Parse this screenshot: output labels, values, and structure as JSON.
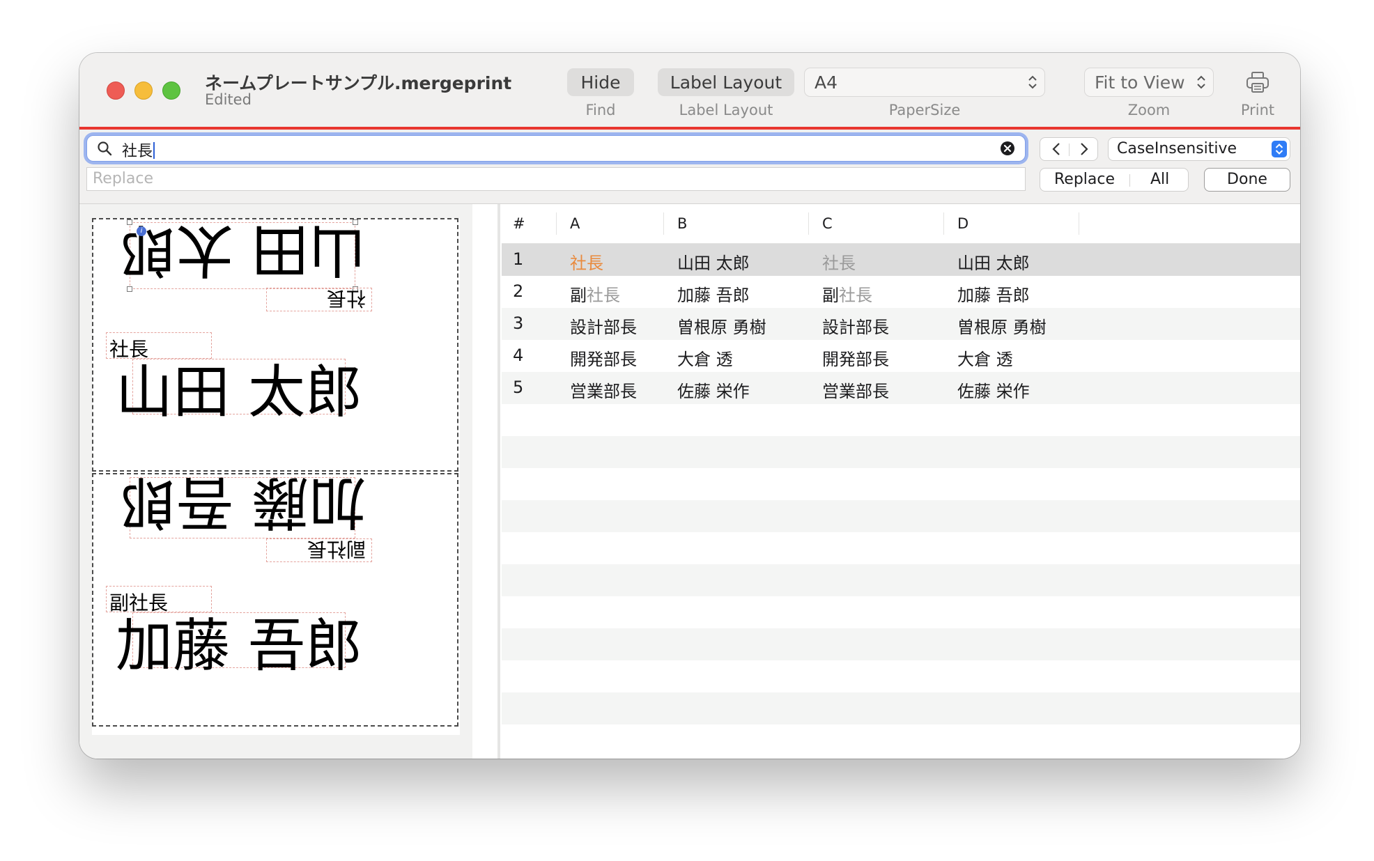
{
  "window": {
    "title": "ネームプレートサンプル.mergeprint",
    "subtitle": "Edited"
  },
  "toolbar": {
    "find_button": "Hide",
    "find_label": "Find",
    "layout_button": "Label Layout",
    "layout_label": "Label Layout",
    "paper_value": "A4",
    "paper_label": "PaperSize",
    "zoom_value": "Fit to View",
    "zoom_label": "Zoom",
    "print_label": "Print",
    "accent_color": "#e8362f"
  },
  "find": {
    "search_value": "社長",
    "replace_placeholder": "Replace",
    "case_option": "CaseInsensitive",
    "replace_button": "Replace",
    "all_button": "All",
    "done_button": "Done"
  },
  "preview": {
    "labels": [
      {
        "name": "山田 太郎",
        "title": "社長"
      },
      {
        "name": "加藤 吾郎",
        "title": "副社長"
      }
    ]
  },
  "table": {
    "headers": [
      "#",
      "A",
      "B",
      "C",
      "D"
    ],
    "rows": [
      {
        "num": "1",
        "a_pre": "",
        "a_match": "社長",
        "b": "山田 太郎",
        "c_pre": "",
        "c_match": "社長",
        "d": "山田 太郎"
      },
      {
        "num": "2",
        "a_pre": "副",
        "a_match": "社長",
        "b": "加藤 吾郎",
        "c_pre": "副",
        "c_match": "社長",
        "d": "加藤 吾郎"
      },
      {
        "num": "3",
        "a_pre": "設計部長",
        "a_match": "",
        "b": "曽根原 勇樹",
        "c_pre": "設計部長",
        "c_match": "",
        "d": "曽根原 勇樹"
      },
      {
        "num": "4",
        "a_pre": "開発部長",
        "a_match": "",
        "b": "大倉 透",
        "c_pre": "開発部長",
        "c_match": "",
        "d": "大倉 透"
      },
      {
        "num": "5",
        "a_pre": "営業部長",
        "a_match": "",
        "b": "佐藤 栄作",
        "c_pre": "営業部長",
        "c_match": "",
        "d": "佐藤 栄作"
      }
    ],
    "current_match_color": "#e98a3d",
    "other_match_color": "#9a9a9a"
  }
}
